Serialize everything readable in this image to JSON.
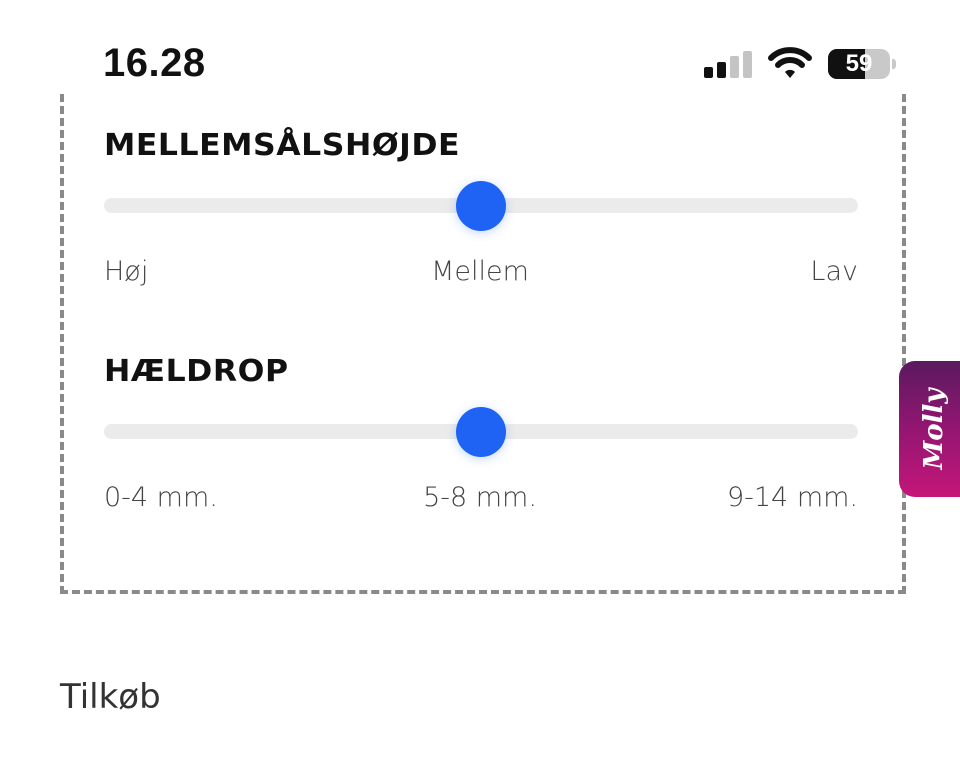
{
  "status_bar": {
    "time": "16.28",
    "battery_percent": "59",
    "battery_level": 0.59,
    "signal_bars_active": 2,
    "signal_bars_total": 4,
    "icons": [
      "cellular-signal-icon",
      "wifi-icon",
      "battery-icon"
    ]
  },
  "filters": {
    "midsole_height": {
      "title": "MELLEMSÅLSHØJDE",
      "labels": [
        "Høj",
        "Mellem",
        "Lav"
      ],
      "value_fraction": 0.5
    },
    "heel_drop": {
      "title": "HÆLDROP",
      "labels": [
        "0-4 mm.",
        "5-8 mm.",
        "9-14 mm."
      ],
      "value_fraction": 0.5
    }
  },
  "chat_widget": {
    "label": "Molly"
  },
  "addons": {
    "title": "Tilkøb"
  },
  "colors": {
    "accent": "#1f63f5",
    "track": "#ebebeb",
    "dashed_border": "#8a8a8a",
    "molly_gradient_top": "#5a1a5f",
    "molly_gradient_bottom": "#c51679"
  }
}
